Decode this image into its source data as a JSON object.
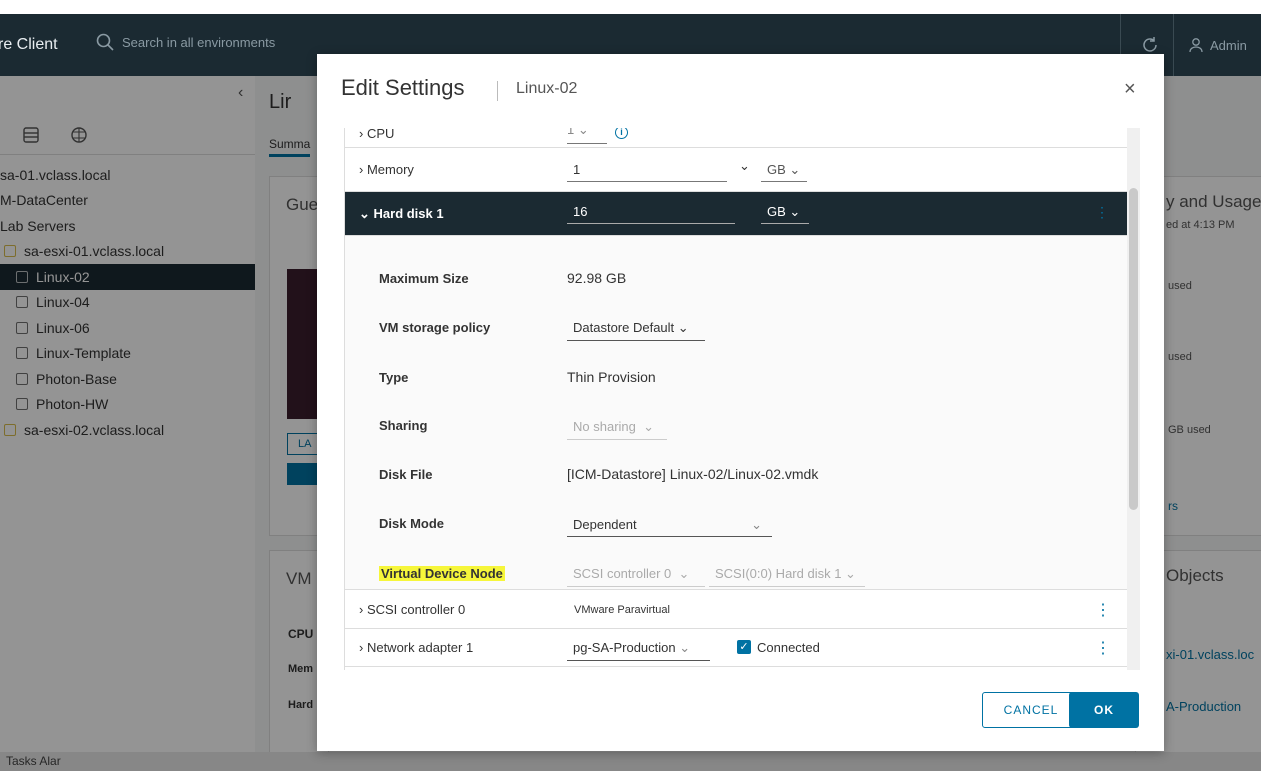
{
  "header": {
    "app_title": "re Client",
    "search_placeholder": "Search in all environments",
    "user_label": "Admin"
  },
  "sidebar": {
    "collapse_glyph": "‹",
    "tree": [
      {
        "label": "sa-01.vclass.local",
        "indent": 0
      },
      {
        "label": "M-DataCenter",
        "indent": 0
      },
      {
        "label": "Lab Servers",
        "indent": 0
      },
      {
        "label": "sa-esxi-01.vclass.local",
        "indent": 1
      },
      {
        "label": "Linux-02",
        "indent": 2,
        "selected": true
      },
      {
        "label": "Linux-04",
        "indent": 2
      },
      {
        "label": "Linux-06",
        "indent": 2
      },
      {
        "label": "Linux-Template",
        "indent": 2
      },
      {
        "label": "Photon-Base",
        "indent": 2
      },
      {
        "label": "Photon-HW",
        "indent": 2
      },
      {
        "label": "sa-esxi-02.vclass.local",
        "indent": 1
      }
    ]
  },
  "main": {
    "title": "Lir",
    "tab_summary": "Summa",
    "card_guest_title": "Gue",
    "card_vm_title": "VM",
    "card_right_title": "y and Usage",
    "card_right_sub": "ed at 4:13 PM",
    "usage1": "used",
    "usage2": "used",
    "usage3": "GB used",
    "rs_link": "rs",
    "objects_title": "Objects",
    "host_link": "xi-01.vclass.loc",
    "net_link": "A-Production",
    "launch_btn": "LA",
    "vm_cpu": "CPU",
    "vm_mem": "Mem",
    "vm_hard": "Hard"
  },
  "statusbar": {
    "text": "Tasks     Alar"
  },
  "modal": {
    "title": "Edit Settings",
    "subtitle": "Linux-02",
    "close_glyph": "×",
    "cpu": {
      "label": "CPU",
      "value": "1"
    },
    "memory": {
      "label": "Memory",
      "value": "1",
      "unit": "GB"
    },
    "hard_disk": {
      "label": "Hard disk 1",
      "value": "16",
      "unit": "GB"
    },
    "details": {
      "max_size_label": "Maximum Size",
      "max_size_value": "92.98 GB",
      "storage_policy_label": "VM storage policy",
      "storage_policy_value": "Datastore Default",
      "type_label": "Type",
      "type_value": "Thin Provision",
      "sharing_label": "Sharing",
      "sharing_value": "No sharing",
      "disk_file_label": "Disk File",
      "disk_file_value": "[ICM-Datastore] Linux-02/Linux-02.vmdk",
      "disk_mode_label": "Disk Mode",
      "disk_mode_value": "Dependent",
      "vdn_label": "Virtual Device Node",
      "vdn_controller": "SCSI controller 0",
      "vdn_slot": "SCSI(0:0) Hard disk 1"
    },
    "scsi": {
      "label": "SCSI controller 0",
      "value": "VMware Paravirtual"
    },
    "network": {
      "label": "Network adapter 1",
      "value": "pg-SA-Production",
      "connected_label": "Connected"
    },
    "cancel_label": "CANCEL",
    "ok_label": "OK",
    "accent": "#0072a3",
    "highlight": "#f6f63a"
  }
}
